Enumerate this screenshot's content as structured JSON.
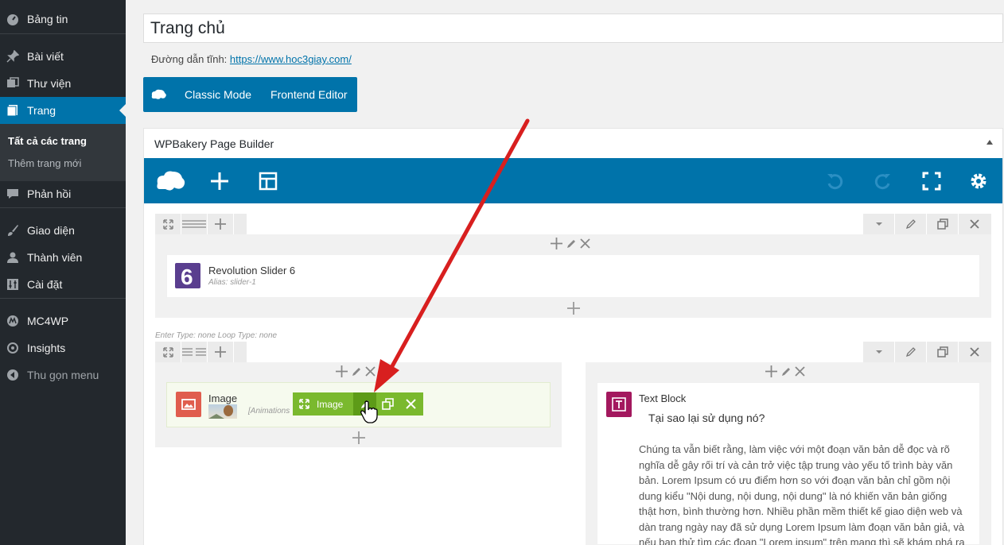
{
  "sidebar": {
    "items": [
      {
        "label": "Bảng tin",
        "icon": "dashboard-icon"
      },
      {
        "label": "Bài viết",
        "icon": "pin-icon"
      },
      {
        "label": "Thư viện",
        "icon": "media-icon"
      },
      {
        "label": "Trang",
        "icon": "pages-icon"
      },
      {
        "label": "Phản hồi",
        "icon": "comment-icon"
      },
      {
        "label": "Giao diện",
        "icon": "brush-icon"
      },
      {
        "label": "Thành viên",
        "icon": "user-icon"
      },
      {
        "label": "Cài đặt",
        "icon": "settings-icon"
      },
      {
        "label": "MC4WP",
        "icon": "mc4wp-icon"
      },
      {
        "label": "Insights",
        "icon": "insights-icon"
      },
      {
        "label": "Thu gọn menu",
        "icon": "collapse-icon"
      }
    ],
    "submenu": [
      "Tất cả các trang",
      "Thêm trang mới"
    ]
  },
  "page": {
    "title": "Trang chủ",
    "permalink_label": "Đường dẫn tĩnh:",
    "permalink_url": "https://www.hoc3giay.com/"
  },
  "mode_bar": {
    "classic": "Classic Mode",
    "frontend": "Frontend Editor"
  },
  "wpbakery": {
    "header": "WPBakery Page Builder",
    "row1": {
      "element_title": "Revolution Slider 6",
      "element_sub": "Alias: slider-1"
    },
    "row2_note": "Enter Type: none  Loop Type: none",
    "image_element": {
      "title": "Image",
      "sub": "[Animations",
      "toolbar_label": "Image"
    },
    "text_block": {
      "title": "Text Block",
      "heading": "Tại sao lại sử dụng nó?",
      "lines": [
        "Chúng ta vẫn biết rằng, làm việc với một đoạn văn bản dễ đọc và rõ",
        "nghĩa dễ gây rối trí và cản trở việc tập trung vào yếu tố trình bày văn",
        "bản. Lorem Ipsum có ưu điểm hơn so với đoạn văn bản chỉ gồm nội",
        "dung kiểu \"Nội dung, nội dung, nội dung\" là nó khiến văn bản giống",
        "thật hơn, bình thường hơn. Nhiều phần mềm thiết kế giao diện web và",
        "dàn trang ngày nay đã sử dụng Lorem Ipsum làm đoạn văn bản giả, và",
        "nếu bạn thử tìm các đoạn \"Lorem ipsum\" trên mạng thì sẽ khám phá ra"
      ]
    }
  },
  "colors": {
    "sidebar_bg": "#23282d",
    "accent": "#0073aa",
    "image_toolbar": "#7ab92e",
    "arrow": "#e02020"
  }
}
